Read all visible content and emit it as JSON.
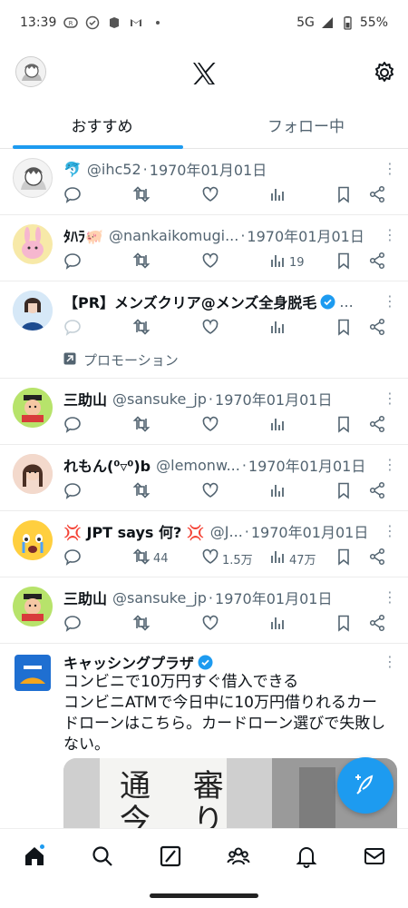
{
  "status": {
    "time": "13:39",
    "network": "5G",
    "battery": "55%",
    "icons": [
      "rakuten-icon",
      "check-circle-icon",
      "box-icon",
      "gmail-icon",
      "dot-icon",
      "signal-icon",
      "battery-icon"
    ]
  },
  "topbar": {
    "logo": "X",
    "avatar_icon": "user-avatar-icon",
    "settings_icon": "gear-icon"
  },
  "tabs": [
    {
      "label": "おすすめ",
      "active": true
    },
    {
      "label": "フォロー中",
      "active": false
    }
  ],
  "tweets": [
    {
      "name": "🐬",
      "handle": "@ihc52",
      "date": "1970年01月01日",
      "views": "",
      "retweets": "",
      "likes": ""
    },
    {
      "name": "ﾀﾊﾗ🐖",
      "handle": "@nankaikomugi...",
      "date": "1970年01月01日",
      "views": "19",
      "retweets": "",
      "likes": ""
    },
    {
      "name": "【PR】メンズクリア@メンズ全身脱毛",
      "handle": "...",
      "date": "",
      "promo": "プロモーション",
      "views": "",
      "retweets": "",
      "likes": ""
    },
    {
      "name": "三助山",
      "handle": "@sansuke_jp",
      "date": "1970年01月01日",
      "views": "",
      "retweets": "",
      "likes": ""
    },
    {
      "name": "れもん(⁰▿⁰)b",
      "handle": "@lemonw...",
      "date": "1970年01月01日",
      "views": "",
      "retweets": "",
      "likes": ""
    },
    {
      "name": "💢 JPT says 何? 💢",
      "handle": "@J...",
      "date": "1970年01月01日",
      "views": "47万",
      "retweets": "44",
      "likes": "1.5万"
    },
    {
      "name": "三助山",
      "handle": "@sansuke_jp",
      "date": "1970年01月01日",
      "views": "",
      "retweets": "",
      "likes": ""
    }
  ],
  "ad": {
    "name": "キャッシングプラザ",
    "body_line1": "コンビニで10万円すぐ借入できる",
    "body_line2": "コンビニATMで今日中に10万円借りれるカードローンはこちら。カードローン選びで失敗しない。",
    "image_text": "通 審 今 り 査 日"
  },
  "separator": "·",
  "more": "⋮",
  "colors": {
    "accent": "#1d9bf0",
    "text": "#0f1419",
    "muted": "#536471"
  }
}
